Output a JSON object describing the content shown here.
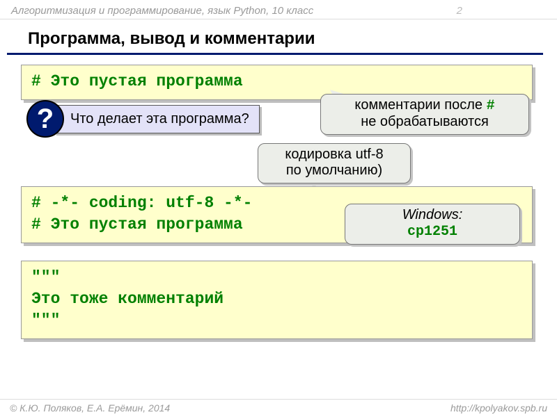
{
  "header": {
    "subject": "Алгоритмизация и программирование, язык Python, 10 класс",
    "page_number": "2"
  },
  "title": "Программа, вывод и комментарии",
  "code1": {
    "line1": "# Это пустая программа"
  },
  "question": {
    "mark": "?",
    "text": "Что делает эта программа?"
  },
  "callout1": {
    "text_before": "комментарии после ",
    "hash": "#",
    "text_after": " не обрабатываются"
  },
  "callout2": {
    "line1": "кодировка utf-8",
    "line2": "по умолчанию)"
  },
  "code2": {
    "line1": "# -*- coding: utf-8 -*-",
    "line2": "# Это пустая программа"
  },
  "callout3": {
    "label": "Windows:",
    "encoding": "cp1251"
  },
  "code3": {
    "line1": "\"\"\"",
    "line2": "Это тоже комментарий",
    "line3": "\"\"\""
  },
  "footer": {
    "left": "© К.Ю. Поляков, Е.А. Ерёмин, 2014",
    "right": "http://kpolyakov.spb.ru"
  }
}
